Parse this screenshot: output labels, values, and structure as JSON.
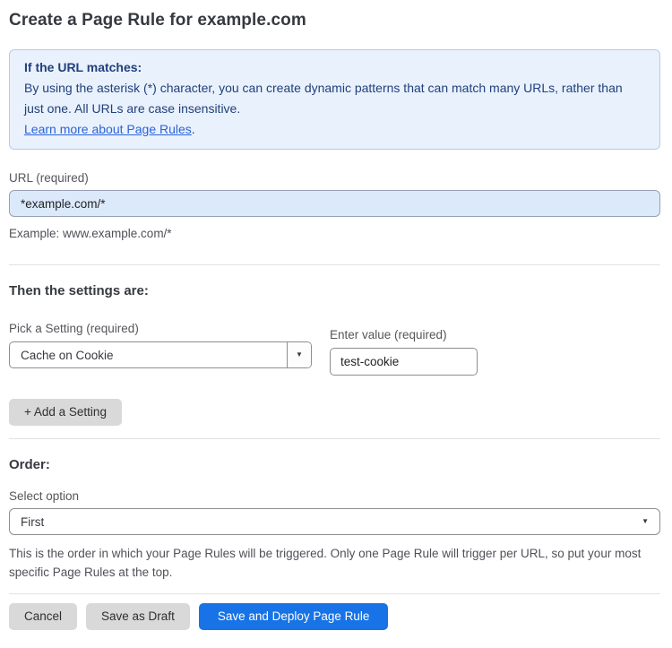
{
  "page": {
    "title": "Create a Page Rule for example.com"
  },
  "info_box": {
    "heading": "If the URL matches:",
    "body": "By using the asterisk (*) character, you can create dynamic patterns that can match many URLs, rather than just one. All URLs are case insensitive.",
    "link_label": "Learn more about Page Rules",
    "link_suffix": "."
  },
  "url_field": {
    "label": "URL (required)",
    "value": "*example.com/*",
    "hint": "Example: www.example.com/*"
  },
  "settings_section": {
    "heading": "Then the settings are:",
    "setting_label": "Pick a Setting (required)",
    "setting_selected": "Cache on Cookie",
    "value_label": "Enter value (required)",
    "value_text": "test-cookie",
    "add_button_label": "+ Add a Setting"
  },
  "order_section": {
    "heading": "Order:",
    "select_label": "Select option",
    "selected_option": "First",
    "hint": "This is the order in which your Page Rules will be triggered. Only one Page Rule will trigger per URL, so put your most specific Page Rules at the top."
  },
  "actions": {
    "cancel_label": "Cancel",
    "save_draft_label": "Save as Draft",
    "save_deploy_label": "Save and Deploy Page Rule"
  },
  "icons": {
    "caret_down": "▼"
  },
  "colors": {
    "accent_blue": "#1773e6",
    "info_box_bg": "#e9f1fc",
    "info_box_border": "#aecdf2",
    "info_text": "#21407c",
    "link_blue": "#2b64d9",
    "url_input_bg": "#dce9fb",
    "gray_button_bg": "#d9d9d9"
  }
}
